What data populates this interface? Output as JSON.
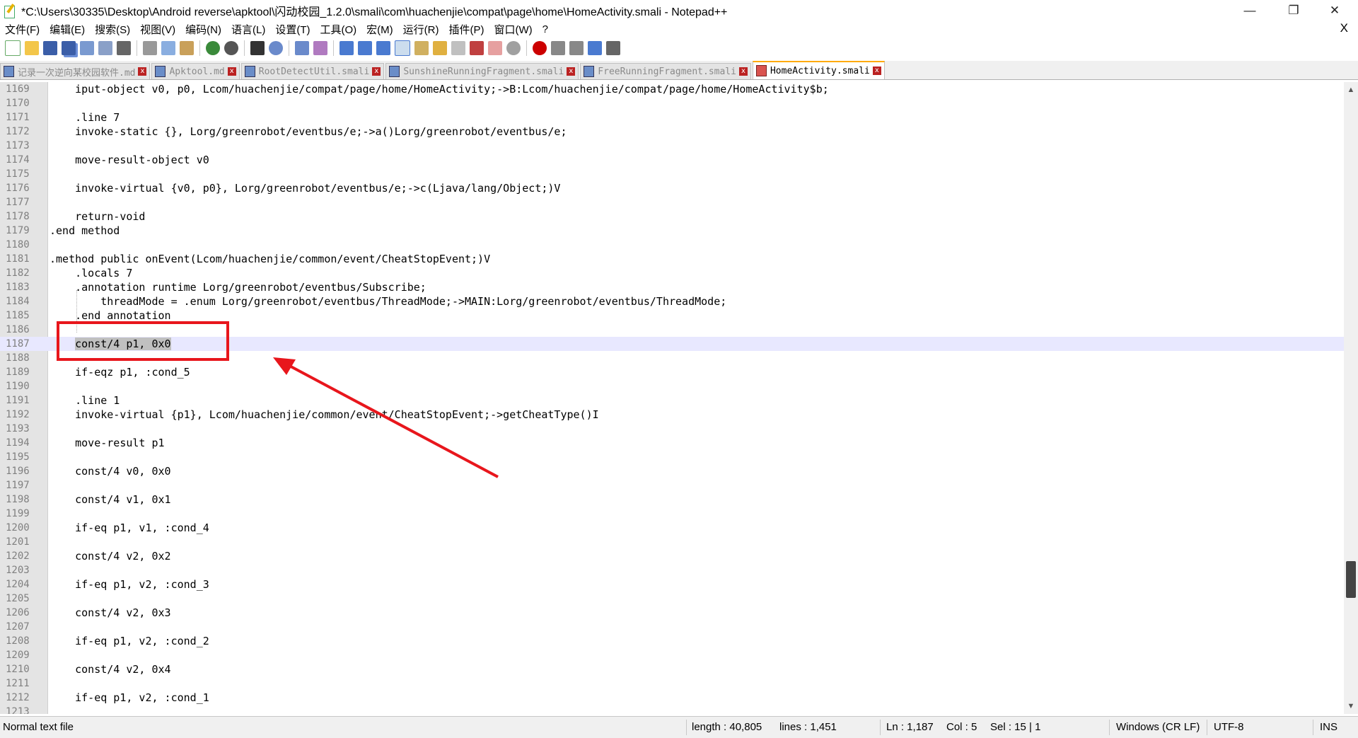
{
  "window": {
    "title": "*C:\\Users\\30335\\Desktop\\Android reverse\\apktool\\闪动校园_1.2.0\\smali\\com\\huachenjie\\compat\\page\\home\\HomeActivity.smali - Notepad++",
    "minimize": "—",
    "restore": "❐",
    "close": "✕"
  },
  "menu": [
    "文件(F)",
    "编辑(E)",
    "搜索(S)",
    "视图(V)",
    "编码(N)",
    "语言(L)",
    "设置(T)",
    "工具(O)",
    "宏(M)",
    "运行(R)",
    "插件(P)",
    "窗口(W)",
    "?"
  ],
  "menu_close": "X",
  "tabs": [
    {
      "label": "记录一次逆向某校园软件.md",
      "icon": "save-icon",
      "active": false
    },
    {
      "label": "Apktool.md",
      "icon": "save-icon",
      "active": false
    },
    {
      "label": "RootDetectUtil.smali",
      "icon": "save-icon",
      "active": false
    },
    {
      "label": "SunshineRunningFragment.smali",
      "icon": "save-icon",
      "active": false
    },
    {
      "label": "FreeRunningFragment.smali",
      "icon": "save-icon",
      "active": false
    },
    {
      "label": "HomeActivity.smali",
      "icon": "unsaved-icon",
      "active": true
    }
  ],
  "tab_close": "x",
  "editor": {
    "current_line": "1187",
    "lines": [
      {
        "n": "1169",
        "t": "    iput-object v0, p0, Lcom/huachenjie/compat/page/home/HomeActivity;->B:Lcom/huachenjie/compat/page/home/HomeActivity$b;"
      },
      {
        "n": "1170",
        "t": ""
      },
      {
        "n": "1171",
        "t": "    .line 7"
      },
      {
        "n": "1172",
        "t": "    invoke-static {}, Lorg/greenrobot/eventbus/e;->a()Lorg/greenrobot/eventbus/e;"
      },
      {
        "n": "1173",
        "t": ""
      },
      {
        "n": "1174",
        "t": "    move-result-object v0"
      },
      {
        "n": "1175",
        "t": ""
      },
      {
        "n": "1176",
        "t": "    invoke-virtual {v0, p0}, Lorg/greenrobot/eventbus/e;->c(Ljava/lang/Object;)V"
      },
      {
        "n": "1177",
        "t": ""
      },
      {
        "n": "1178",
        "t": "    return-void"
      },
      {
        "n": "1179",
        "t": ".end method"
      },
      {
        "n": "1180",
        "t": ""
      },
      {
        "n": "1181",
        "t": ".method public onEvent(Lcom/huachenjie/common/event/CheatStopEvent;)V"
      },
      {
        "n": "1182",
        "t": "    .locals 7"
      },
      {
        "n": "1183",
        "t": "    .annotation runtime Lorg/greenrobot/eventbus/Subscribe;"
      },
      {
        "n": "1184",
        "t": "        threadMode = .enum Lorg/greenrobot/eventbus/ThreadMode;->MAIN:Lorg/greenrobot/eventbus/ThreadMode;"
      },
      {
        "n": "1185",
        "t": "    .end annotation"
      },
      {
        "n": "1186",
        "t": ""
      },
      {
        "n": "1187",
        "t": "    const/4 p1, 0x0"
      },
      {
        "n": "1188",
        "t": ""
      },
      {
        "n": "1189",
        "t": "    if-eqz p1, :cond_5"
      },
      {
        "n": "1190",
        "t": ""
      },
      {
        "n": "1191",
        "t": "    .line 1"
      },
      {
        "n": "1192",
        "t": "    invoke-virtual {p1}, Lcom/huachenjie/common/event/CheatStopEvent;->getCheatType()I"
      },
      {
        "n": "1193",
        "t": ""
      },
      {
        "n": "1194",
        "t": "    move-result p1"
      },
      {
        "n": "1195",
        "t": ""
      },
      {
        "n": "1196",
        "t": "    const/4 v0, 0x0"
      },
      {
        "n": "1197",
        "t": ""
      },
      {
        "n": "1198",
        "t": "    const/4 v1, 0x1"
      },
      {
        "n": "1199",
        "t": ""
      },
      {
        "n": "1200",
        "t": "    if-eq p1, v1, :cond_4"
      },
      {
        "n": "1201",
        "t": ""
      },
      {
        "n": "1202",
        "t": "    const/4 v2, 0x2"
      },
      {
        "n": "1203",
        "t": ""
      },
      {
        "n": "1204",
        "t": "    if-eq p1, v2, :cond_3"
      },
      {
        "n": "1205",
        "t": ""
      },
      {
        "n": "1206",
        "t": "    const/4 v2, 0x3"
      },
      {
        "n": "1207",
        "t": ""
      },
      {
        "n": "1208",
        "t": "    if-eq p1, v2, :cond_2"
      },
      {
        "n": "1209",
        "t": ""
      },
      {
        "n": "1210",
        "t": "    const/4 v2, 0x4"
      },
      {
        "n": "1211",
        "t": ""
      },
      {
        "n": "1212",
        "t": "    if-eq p1, v2, :cond_1"
      },
      {
        "n": "1213",
        "t": ""
      }
    ]
  },
  "scrollbar": {
    "up": "▲",
    "down": "▼"
  },
  "status": {
    "file_type": "Normal text file",
    "length": "length : 40,805",
    "lines": "lines : 1,451",
    "ln": "Ln : 1,187",
    "col": "Col : 5",
    "sel": "Sel : 15 | 1",
    "eol": "Windows (CR LF)",
    "encoding": "UTF-8",
    "mode": "INS"
  },
  "colors": {
    "annotation": "#e8161c",
    "current_line_bg": "#e8e8ff",
    "active_tab_accent": "#ffaa00"
  }
}
